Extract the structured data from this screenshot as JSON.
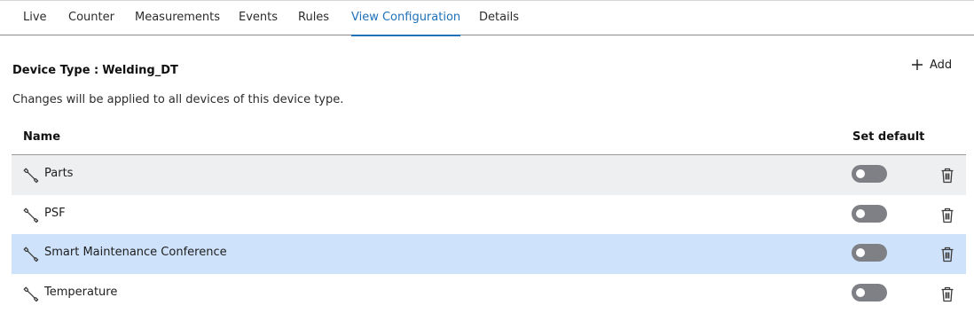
{
  "tabs": [
    {
      "label": "Live"
    },
    {
      "label": "Counter"
    },
    {
      "label": "Measurements"
    },
    {
      "label": "Events"
    },
    {
      "label": "Rules"
    },
    {
      "label": "View Configuration",
      "active": true
    },
    {
      "label": "Details"
    }
  ],
  "header": {
    "device_type_label": "Device Type :",
    "device_type_value": "Welding_DT",
    "add_label": "Add",
    "note": "Changes will be applied to all devices of this device type."
  },
  "table": {
    "columns": {
      "name": "Name",
      "set_default": "Set default"
    },
    "rows": [
      {
        "name": "Parts",
        "default": false,
        "icon": "wrench-icon"
      },
      {
        "name": "PSF",
        "default": false,
        "icon": "wrench-icon"
      },
      {
        "name": "Smart Maintenance Conference",
        "default": false,
        "icon": "wrench-icon",
        "selected": true
      },
      {
        "name": "Temperature",
        "default": false,
        "icon": "wrench-icon"
      }
    ]
  },
  "colors": {
    "accent": "#1f71b8",
    "selected_row": "#cfe2fb",
    "shaded_row": "#eeeff0",
    "toggle_off": "#7e8086"
  }
}
